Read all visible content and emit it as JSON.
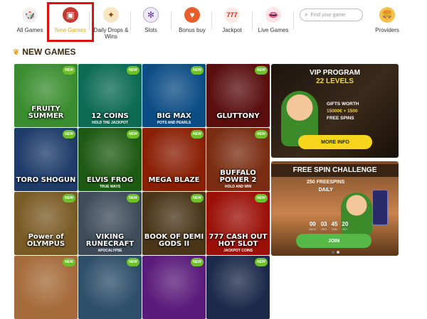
{
  "nav": {
    "items": [
      {
        "label": "All Games",
        "icon": "dice-icon"
      },
      {
        "label": "New Games",
        "icon": "arcade-machine-icon"
      },
      {
        "label": "Daily Drops & Wins",
        "icon": "drops-icon"
      },
      {
        "label": "Slots",
        "icon": "slots-wheel-icon"
      },
      {
        "label": "Bonus buy",
        "icon": "heart-coin-icon"
      },
      {
        "label": "Jackpot",
        "icon": "jackpot-777-icon"
      },
      {
        "label": "Live Games",
        "icon": "lips-icon"
      },
      {
        "label": "Providers",
        "icon": "burger-icon"
      }
    ],
    "active_index": 1,
    "search_placeholder": "Find your game"
  },
  "section": {
    "title": "NEW GAMES"
  },
  "badge_label": "NEW",
  "games": [
    {
      "name": "FRUITY SUMMER",
      "sub": "",
      "bg": "#3a8d2f"
    },
    {
      "name": "12 COINS",
      "sub": "HOLD THE JACKPOT",
      "bg": "#0c6b52"
    },
    {
      "name": "BIG MAX",
      "sub": "POTS AND PEARLS",
      "bg": "#0d4d85"
    },
    {
      "name": "GLUTTONY",
      "sub": "",
      "bg": "#5a0e0e"
    },
    {
      "name": "TORO SHOGUN",
      "sub": "",
      "bg": "#1e3b6a"
    },
    {
      "name": "ELVIS FROG",
      "sub": "TRUE WAYS",
      "bg": "#1f5a14"
    },
    {
      "name": "MEGA BLAZE",
      "sub": "",
      "bg": "#8a1f05"
    },
    {
      "name": "BUFFALO POWER 2",
      "sub": "HOLD AND WIN",
      "bg": "#7a2d12"
    },
    {
      "name": "Power of OLYMPUS",
      "sub": "",
      "bg": "#7a5b25"
    },
    {
      "name": "VIKING RUNECRAFT",
      "sub": "APOCALYPSE",
      "bg": "#3e4c5a"
    },
    {
      "name": "BOOK OF DEMI GODS II",
      "sub": "",
      "bg": "#4a3519"
    },
    {
      "name": "777 CASH OUT HOT SLOT",
      "sub": "JACKPOT COINS",
      "bg": "#9b1108"
    },
    {
      "name": "",
      "sub": "",
      "bg": "#a56b3a"
    },
    {
      "name": "",
      "sub": "",
      "bg": "#2e4f6a"
    },
    {
      "name": "",
      "sub": "",
      "bg": "#5a1b7a"
    },
    {
      "name": "",
      "sub": "",
      "bg": "#1c2a4a"
    }
  ],
  "vip": {
    "title": "VIP PROGRAM",
    "levels": "22 LEVELS",
    "gifts_line1": "GIFTS WORTH",
    "gifts_line2": "15000€ + 1500",
    "gifts_line3": "FREE SPINS",
    "button": "MORE INFO"
  },
  "freespin": {
    "title": "FREE SPIN CHALLENGE",
    "line1": "250 FREESPINS",
    "line2": "DAILY",
    "timer": [
      {
        "value": "00",
        "label": "DAYS"
      },
      {
        "value": "03",
        "label": "HRS"
      },
      {
        "value": "45",
        "label": "MIN"
      },
      {
        "value": "20",
        "label": "SEC"
      }
    ],
    "button": "JOIN"
  },
  "colors": {
    "accent": "#f7d51d",
    "green": "#56b947",
    "highlight": "#e11010"
  }
}
